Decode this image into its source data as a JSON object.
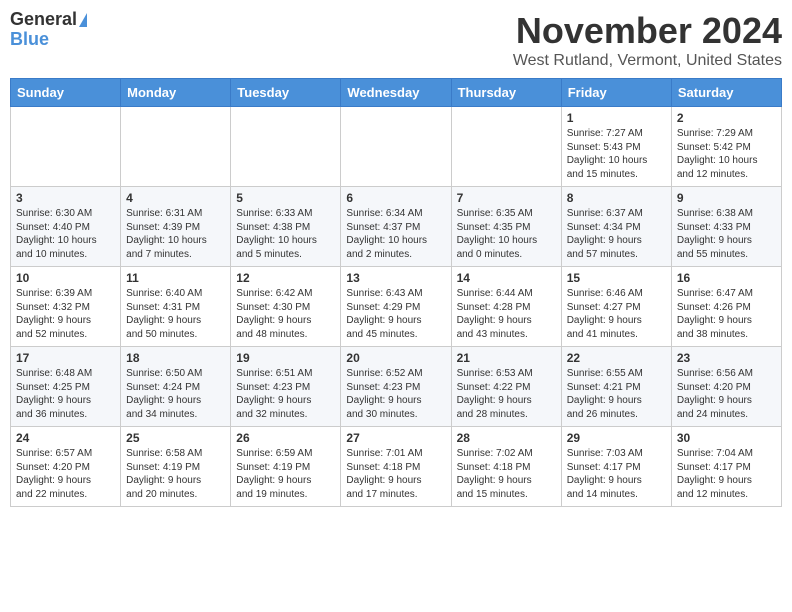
{
  "header": {
    "logo_line1": "General",
    "logo_line2": "Blue",
    "month": "November 2024",
    "location": "West Rutland, Vermont, United States"
  },
  "days_of_week": [
    "Sunday",
    "Monday",
    "Tuesday",
    "Wednesday",
    "Thursday",
    "Friday",
    "Saturday"
  ],
  "weeks": [
    [
      {
        "day": "",
        "info": ""
      },
      {
        "day": "",
        "info": ""
      },
      {
        "day": "",
        "info": ""
      },
      {
        "day": "",
        "info": ""
      },
      {
        "day": "",
        "info": ""
      },
      {
        "day": "1",
        "info": "Sunrise: 7:27 AM\nSunset: 5:43 PM\nDaylight: 10 hours\nand 15 minutes."
      },
      {
        "day": "2",
        "info": "Sunrise: 7:29 AM\nSunset: 5:42 PM\nDaylight: 10 hours\nand 12 minutes."
      }
    ],
    [
      {
        "day": "3",
        "info": "Sunrise: 6:30 AM\nSunset: 4:40 PM\nDaylight: 10 hours\nand 10 minutes."
      },
      {
        "day": "4",
        "info": "Sunrise: 6:31 AM\nSunset: 4:39 PM\nDaylight: 10 hours\nand 7 minutes."
      },
      {
        "day": "5",
        "info": "Sunrise: 6:33 AM\nSunset: 4:38 PM\nDaylight: 10 hours\nand 5 minutes."
      },
      {
        "day": "6",
        "info": "Sunrise: 6:34 AM\nSunset: 4:37 PM\nDaylight: 10 hours\nand 2 minutes."
      },
      {
        "day": "7",
        "info": "Sunrise: 6:35 AM\nSunset: 4:35 PM\nDaylight: 10 hours\nand 0 minutes."
      },
      {
        "day": "8",
        "info": "Sunrise: 6:37 AM\nSunset: 4:34 PM\nDaylight: 9 hours\nand 57 minutes."
      },
      {
        "day": "9",
        "info": "Sunrise: 6:38 AM\nSunset: 4:33 PM\nDaylight: 9 hours\nand 55 minutes."
      }
    ],
    [
      {
        "day": "10",
        "info": "Sunrise: 6:39 AM\nSunset: 4:32 PM\nDaylight: 9 hours\nand 52 minutes."
      },
      {
        "day": "11",
        "info": "Sunrise: 6:40 AM\nSunset: 4:31 PM\nDaylight: 9 hours\nand 50 minutes."
      },
      {
        "day": "12",
        "info": "Sunrise: 6:42 AM\nSunset: 4:30 PM\nDaylight: 9 hours\nand 48 minutes."
      },
      {
        "day": "13",
        "info": "Sunrise: 6:43 AM\nSunset: 4:29 PM\nDaylight: 9 hours\nand 45 minutes."
      },
      {
        "day": "14",
        "info": "Sunrise: 6:44 AM\nSunset: 4:28 PM\nDaylight: 9 hours\nand 43 minutes."
      },
      {
        "day": "15",
        "info": "Sunrise: 6:46 AM\nSunset: 4:27 PM\nDaylight: 9 hours\nand 41 minutes."
      },
      {
        "day": "16",
        "info": "Sunrise: 6:47 AM\nSunset: 4:26 PM\nDaylight: 9 hours\nand 38 minutes."
      }
    ],
    [
      {
        "day": "17",
        "info": "Sunrise: 6:48 AM\nSunset: 4:25 PM\nDaylight: 9 hours\nand 36 minutes."
      },
      {
        "day": "18",
        "info": "Sunrise: 6:50 AM\nSunset: 4:24 PM\nDaylight: 9 hours\nand 34 minutes."
      },
      {
        "day": "19",
        "info": "Sunrise: 6:51 AM\nSunset: 4:23 PM\nDaylight: 9 hours\nand 32 minutes."
      },
      {
        "day": "20",
        "info": "Sunrise: 6:52 AM\nSunset: 4:23 PM\nDaylight: 9 hours\nand 30 minutes."
      },
      {
        "day": "21",
        "info": "Sunrise: 6:53 AM\nSunset: 4:22 PM\nDaylight: 9 hours\nand 28 minutes."
      },
      {
        "day": "22",
        "info": "Sunrise: 6:55 AM\nSunset: 4:21 PM\nDaylight: 9 hours\nand 26 minutes."
      },
      {
        "day": "23",
        "info": "Sunrise: 6:56 AM\nSunset: 4:20 PM\nDaylight: 9 hours\nand 24 minutes."
      }
    ],
    [
      {
        "day": "24",
        "info": "Sunrise: 6:57 AM\nSunset: 4:20 PM\nDaylight: 9 hours\nand 22 minutes."
      },
      {
        "day": "25",
        "info": "Sunrise: 6:58 AM\nSunset: 4:19 PM\nDaylight: 9 hours\nand 20 minutes."
      },
      {
        "day": "26",
        "info": "Sunrise: 6:59 AM\nSunset: 4:19 PM\nDaylight: 9 hours\nand 19 minutes."
      },
      {
        "day": "27",
        "info": "Sunrise: 7:01 AM\nSunset: 4:18 PM\nDaylight: 9 hours\nand 17 minutes."
      },
      {
        "day": "28",
        "info": "Sunrise: 7:02 AM\nSunset: 4:18 PM\nDaylight: 9 hours\nand 15 minutes."
      },
      {
        "day": "29",
        "info": "Sunrise: 7:03 AM\nSunset: 4:17 PM\nDaylight: 9 hours\nand 14 minutes."
      },
      {
        "day": "30",
        "info": "Sunrise: 7:04 AM\nSunset: 4:17 PM\nDaylight: 9 hours\nand 12 minutes."
      }
    ]
  ]
}
